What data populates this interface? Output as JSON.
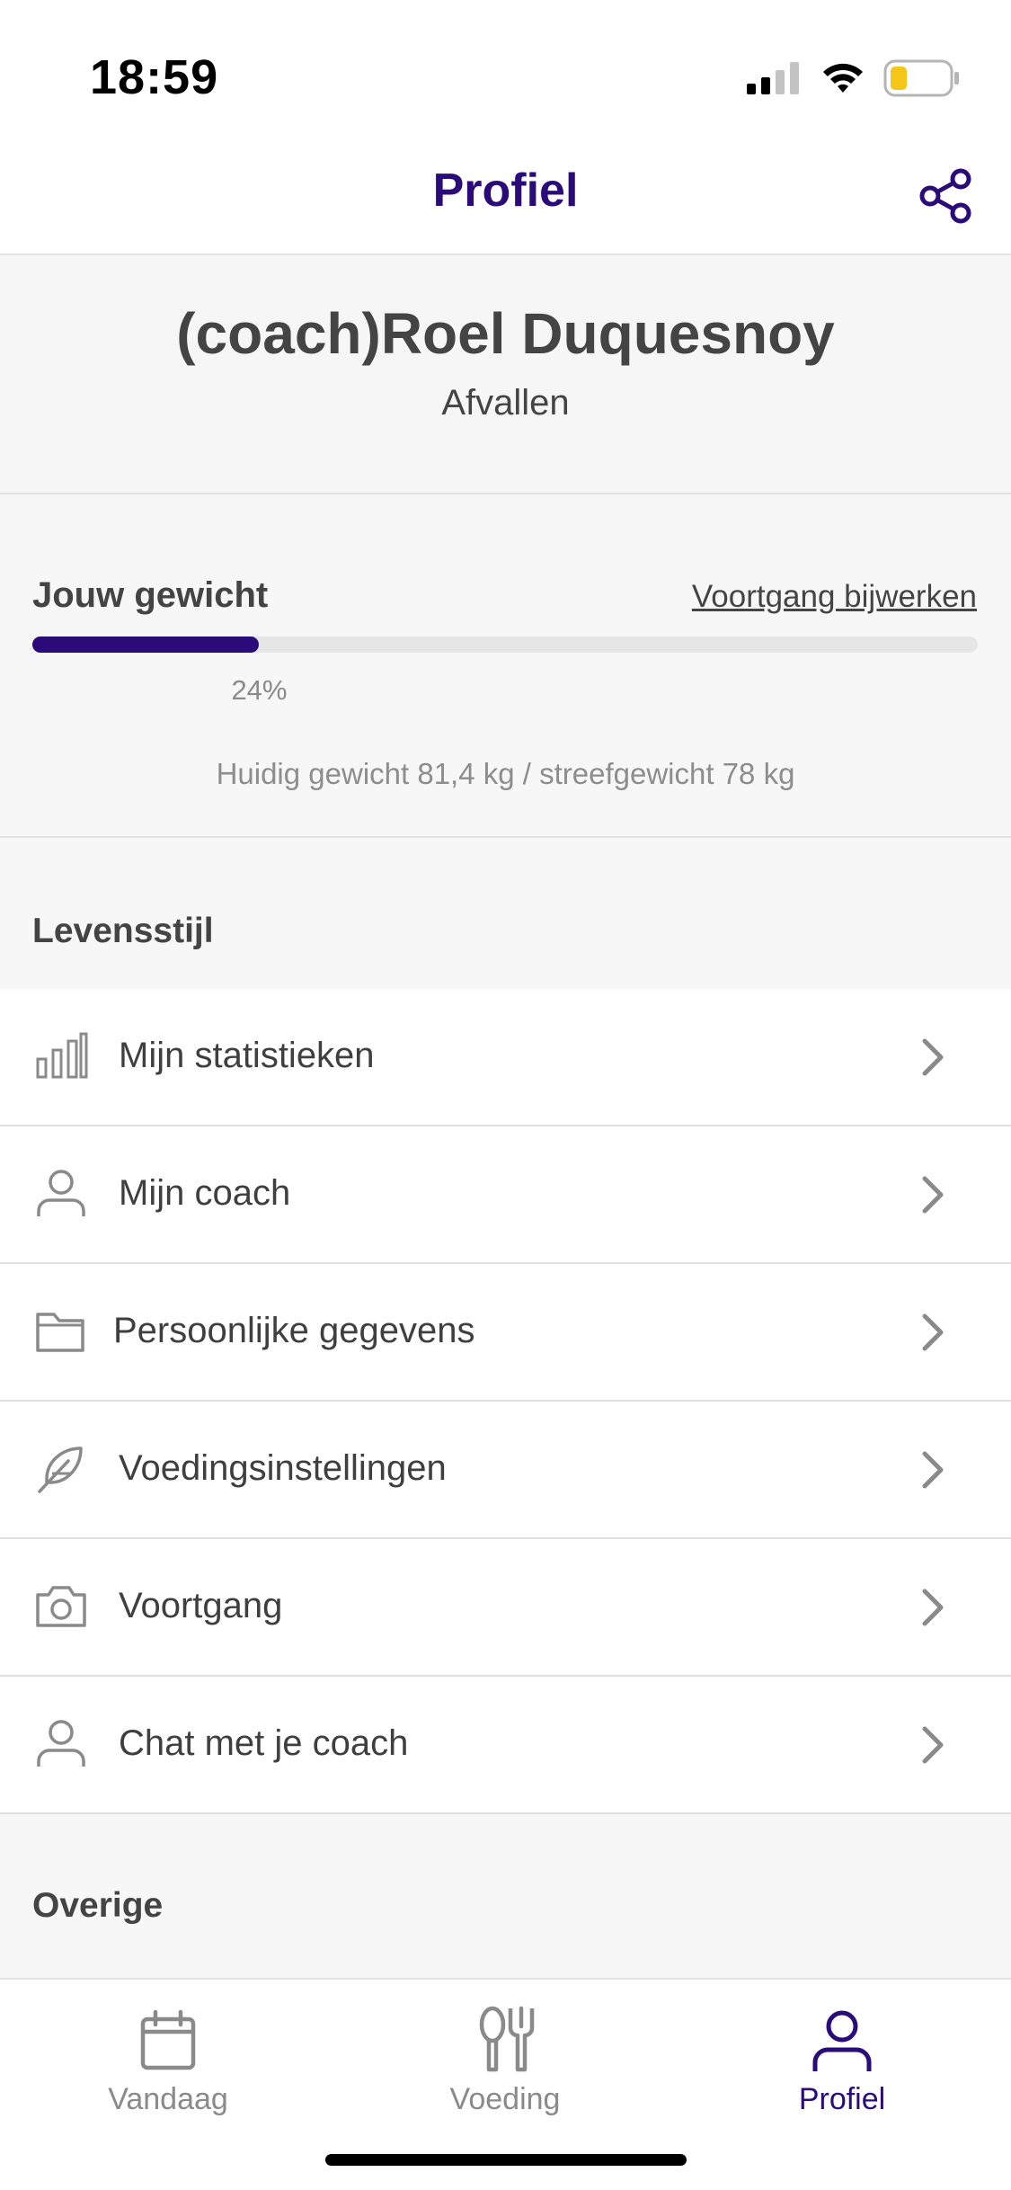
{
  "status_bar": {
    "time": "18:59"
  },
  "header": {
    "title": "Profiel",
    "share_icon": "share-icon"
  },
  "profile": {
    "name": "(coach)Roel Duquesnoy",
    "goal": "Afvallen"
  },
  "weight": {
    "title": "Jouw gewicht",
    "update_link": "Voortgang bijwerken",
    "progress_percent": 24,
    "progress_label": "24%",
    "info": "Huidig gewicht 81,4 kg / streefgewicht 78 kg"
  },
  "sections": {
    "lifestyle_title": "Levensstijl",
    "other_title": "Overige"
  },
  "menu": [
    {
      "label": "Mijn statistieken",
      "icon": "bar-chart-icon"
    },
    {
      "label": "Mijn coach",
      "icon": "person-icon"
    },
    {
      "label": "Persoonlijke gegevens",
      "icon": "folder-icon"
    },
    {
      "label": "Voedingsinstellingen",
      "icon": "feather-icon"
    },
    {
      "label": "Voortgang",
      "icon": "camera-icon"
    },
    {
      "label": "Chat met je coach",
      "icon": "person-icon"
    }
  ],
  "bottom_nav": [
    {
      "label": "Vandaag",
      "icon": "calendar-icon",
      "active": false
    },
    {
      "label": "Voeding",
      "icon": "cutlery-icon",
      "active": false
    },
    {
      "label": "Profiel",
      "icon": "person-icon",
      "active": true
    }
  ],
  "colors": {
    "accent": "#2b0a7a",
    "muted": "#8a8a8a",
    "battery": "#f5c518"
  }
}
